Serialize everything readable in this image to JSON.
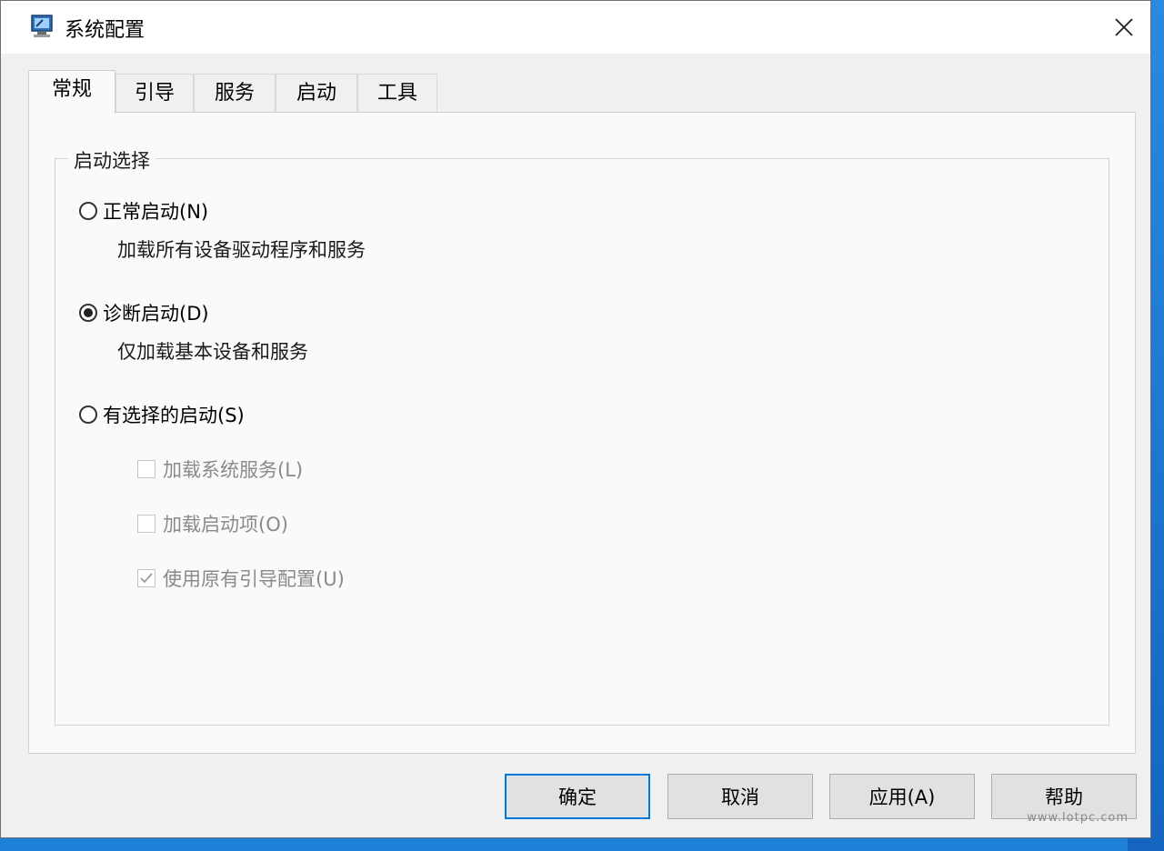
{
  "window": {
    "title": "系统配置",
    "icon": "msconfig-icon"
  },
  "tabs": [
    {
      "label": "常规",
      "active": true
    },
    {
      "label": "引导",
      "active": false
    },
    {
      "label": "服务",
      "active": false
    },
    {
      "label": "启动",
      "active": false
    },
    {
      "label": "工具",
      "active": false
    }
  ],
  "startup": {
    "group_label": "启动选择",
    "options": [
      {
        "label": "正常启动(N)",
        "description": "加载所有设备驱动程序和服务",
        "selected": false
      },
      {
        "label": "诊断启动(D)",
        "description": "仅加载基本设备和服务",
        "selected": true
      },
      {
        "label": "有选择的启动(S)",
        "selected": false
      }
    ],
    "selective": [
      {
        "label": "加载系统服务(L)",
        "checked": false,
        "enabled": false
      },
      {
        "label": "加载启动项(O)",
        "checked": false,
        "enabled": false
      },
      {
        "label": "使用原有引导配置(U)",
        "checked": true,
        "enabled": false
      }
    ]
  },
  "buttons": {
    "ok": "确定",
    "cancel": "取消",
    "apply": "应用(A)",
    "help": "帮助"
  },
  "watermark": "www.lotpc.com"
}
